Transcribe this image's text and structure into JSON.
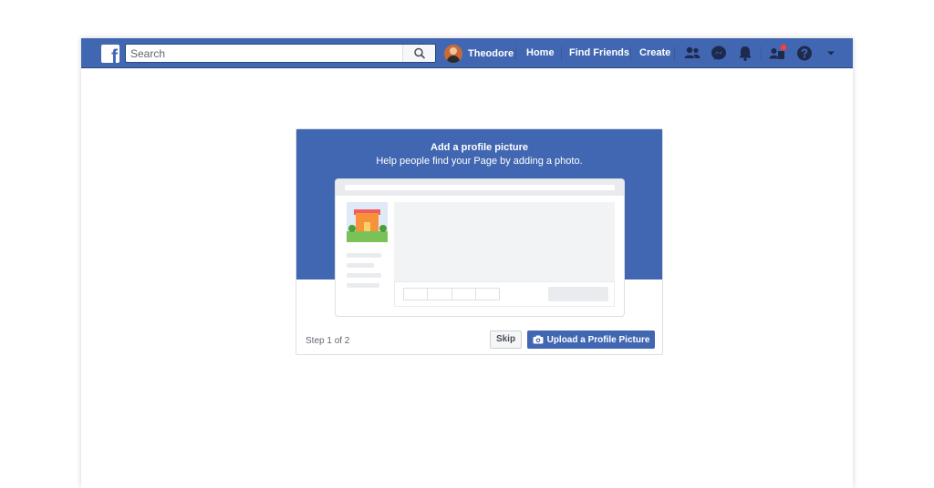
{
  "header": {
    "logo_letter": "f",
    "search_placeholder": "Search",
    "user_name": "Theodore",
    "nav": [
      "Home",
      "Find Friends",
      "Create"
    ],
    "icons": [
      "friend-requests-icon",
      "messenger-icon",
      "notifications-icon",
      "quick-help-icon",
      "help-icon",
      "account-menu-icon"
    ],
    "notification_badge_color": "#fa3e3e"
  },
  "card": {
    "title": "Add a profile picture",
    "subtitle": "Help people find your Page by adding a photo.",
    "step": "Step 1 of 2",
    "skip_label": "Skip",
    "upload_label": "Upload a Profile Picture"
  },
  "colors": {
    "brand": "#4267b2",
    "background": "#ffffff"
  }
}
